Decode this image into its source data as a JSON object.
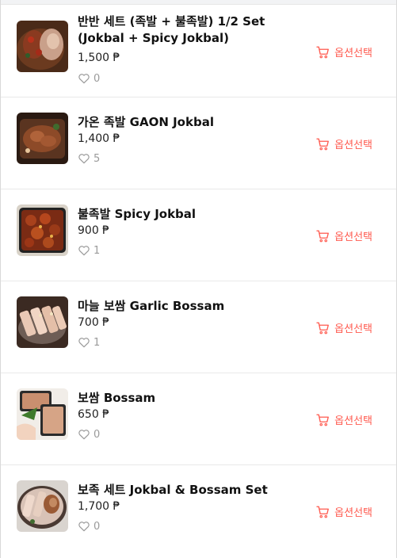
{
  "colors": {
    "accent": "#ff5a4f",
    "muted": "#9a9a9a",
    "divider": "#e9e9e9"
  },
  "icons": {
    "cart": "shopping-cart-icon",
    "like": "heart-outline-icon"
  },
  "menu_items": [
    {
      "title": "반반 세트 (족발 + 불족발) 1/2 Set (Jokbal + Spicy Jokbal)",
      "price": "1,500 ₱",
      "likes": "0",
      "cart_label": "옵션선택"
    },
    {
      "title": "가온 족발 GAON Jokbal",
      "price": "1,400 ₱",
      "likes": "5",
      "cart_label": "옵션선택"
    },
    {
      "title": "불족발 Spicy Jokbal",
      "price": "900 ₱",
      "likes": "1",
      "cart_label": "옵션선택"
    },
    {
      "title": "마늘 보쌈 Garlic Bossam",
      "price": "700 ₱",
      "likes": "1",
      "cart_label": "옵션선택"
    },
    {
      "title": "보쌈 Bossam",
      "price": "650 ₱",
      "likes": "0",
      "cart_label": "옵션선택"
    },
    {
      "title": "보족 세트 Jokbal & Bossam Set",
      "price": "1,700 ₱",
      "likes": "0",
      "cart_label": "옵션선택"
    }
  ]
}
